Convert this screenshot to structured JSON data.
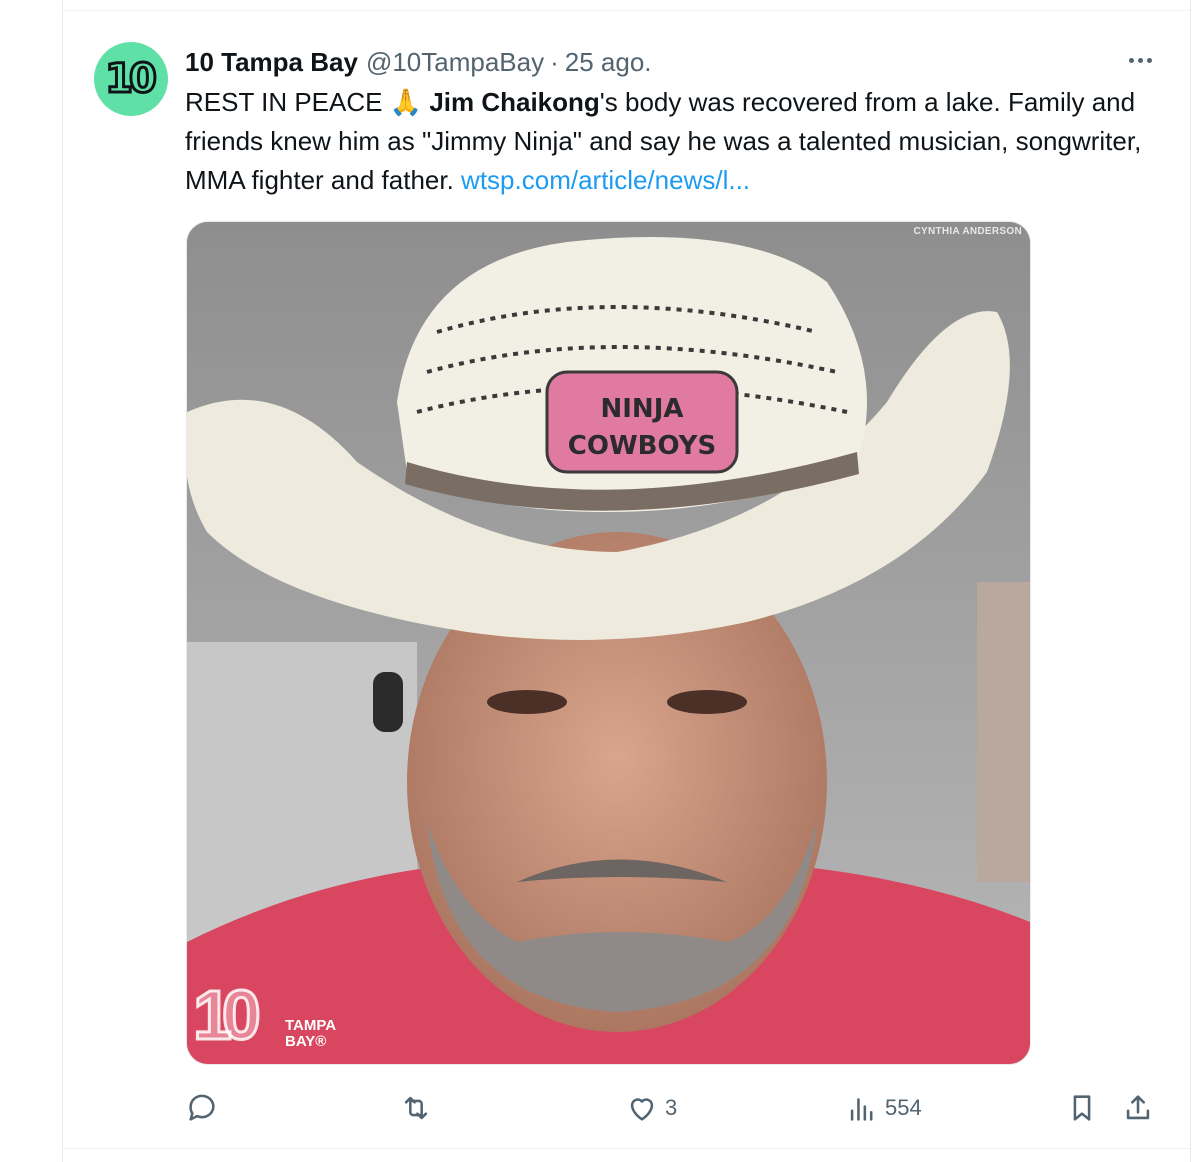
{
  "tweet": {
    "author_name": "10 Tampa Bay",
    "author_handle": "@10TampaBay",
    "separator": "·",
    "date": "25 ago.",
    "avatar_icon": "ten-logo-icon",
    "avatar_color": "#5fe0a6",
    "text_prefix": "REST IN PEACE",
    "emoji": "🙏",
    "bold_name": "Jim Chaikong",
    "text_body": "'s body was recovered from a lake. Family and friends knew him as \"Jimmy Ninja\" and say he was a talented musician, songwriter, MMA fighter and father.",
    "link_text": "wtsp.com/article/news/l...",
    "link_color": "#1d9bf0"
  },
  "media": {
    "photo_credit": "CYNTHIA ANDERSON",
    "hat_patch_line1": "NINJA",
    "hat_patch_line2": "COWBOYS",
    "watermark_number": "10",
    "watermark_line1": "TAMPA",
    "watermark_line2": "BAY®"
  },
  "actions": {
    "reply_count": "",
    "retweet_count": "",
    "like_count": "3",
    "views_count": "554"
  },
  "icons": [
    "more-icon",
    "reply-icon",
    "retweet-icon",
    "like-icon",
    "views-icon",
    "bookmark-icon",
    "share-icon"
  ]
}
